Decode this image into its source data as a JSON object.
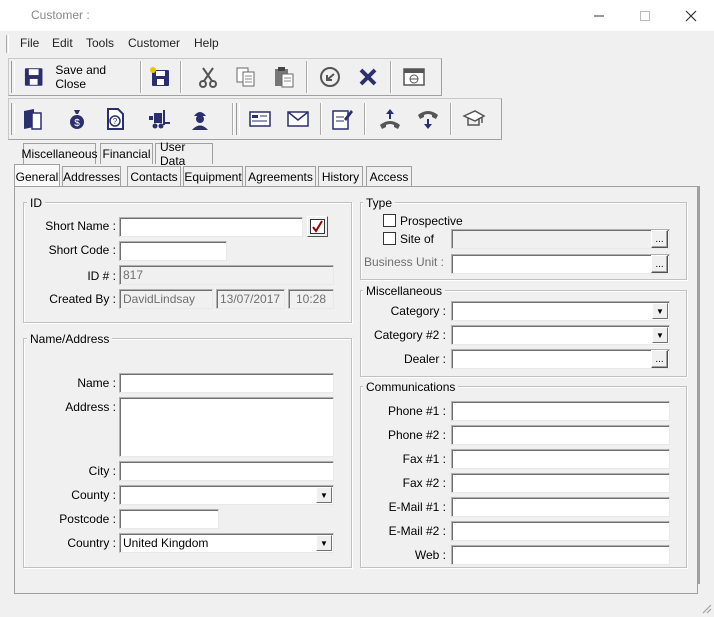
{
  "window": {
    "title": "Customer :",
    "minimize_icon": "minimize-icon",
    "maximize_icon": "maximize-icon",
    "close_icon": "close-icon"
  },
  "menu": {
    "items": [
      {
        "label": "File"
      },
      {
        "label": "Edit"
      },
      {
        "label": "Tools"
      },
      {
        "label": "Customer"
      },
      {
        "label": "Help"
      }
    ]
  },
  "toolbar1": {
    "save_close_label": "Save and Close",
    "buttons": [
      {
        "icon": "floppy-disk-icon"
      },
      {
        "icon": "save-new-icon"
      },
      {
        "icon": "cut-icon"
      },
      {
        "icon": "copy-icon"
      },
      {
        "icon": "paste-icon"
      },
      {
        "icon": "undo-icon"
      },
      {
        "icon": "delete-icon"
      },
      {
        "icon": "web-window-icon"
      }
    ]
  },
  "toolbar2": {
    "buttons": [
      {
        "icon": "book-icon"
      },
      {
        "icon": "money-bag-icon"
      },
      {
        "icon": "question-document-icon"
      },
      {
        "icon": "forklift-icon"
      },
      {
        "icon": "engineer-icon"
      },
      {
        "icon": "message-card-icon"
      },
      {
        "icon": "envelope-icon"
      },
      {
        "icon": "edit-note-icon"
      },
      {
        "icon": "phone-outgoing-icon"
      },
      {
        "icon": "phone-incoming-icon"
      },
      {
        "icon": "mortarboard-icon"
      }
    ]
  },
  "tabs_row1": [
    "Miscellaneous",
    "Financial",
    "User Data"
  ],
  "tabs_row2": [
    "General",
    "Addresses",
    "Contacts",
    "Equipment",
    "Agreements",
    "History",
    "Access"
  ],
  "active_tab": "General",
  "id_group": {
    "title": "ID",
    "short_name_label": "Short Name :",
    "short_name_value": "",
    "short_code_label": "Short Code :",
    "short_code_value": "",
    "id_label": "ID # :",
    "id_value": "817",
    "created_by_label": "Created By :",
    "created_by_user": "DavidLindsay",
    "created_date": "13/07/2017",
    "created_time": "10:28"
  },
  "name_address_group": {
    "title": "Name/Address",
    "name_label": "Name :",
    "name_value": "",
    "address_label": "Address :",
    "address_value": "",
    "city_label": "City :",
    "city_value": "",
    "county_label": "County :",
    "county_value": "",
    "postcode_label": "Postcode :",
    "postcode_value": "",
    "country_label": "Country :",
    "country_value": "United Kingdom"
  },
  "type_group": {
    "title": "Type",
    "prospective_label": "Prospective",
    "prospective_checked": false,
    "site_of_label": "Site of",
    "site_of_checked": false,
    "site_of_value": "",
    "business_unit_label": "Business Unit :",
    "business_unit_value": ""
  },
  "misc_group": {
    "title": "Miscellaneous",
    "category_label": "Category :",
    "category_value": "",
    "category2_label": "Category #2 :",
    "category2_value": "",
    "dealer_label": "Dealer :",
    "dealer_value": ""
  },
  "comms_group": {
    "title": "Communications",
    "phone1_label": "Phone #1 :",
    "phone2_label": "Phone #2 :",
    "fax1_label": "Fax #1 :",
    "fax2_label": "Fax #2 :",
    "email1_label": "E-Mail #1 :",
    "email2_label": "E-Mail #2 :",
    "web_label": "Web :",
    "phone1_value": "",
    "phone2_value": "",
    "fax1_value": "",
    "fax2_value": "",
    "email1_value": "",
    "email2_value": "",
    "web_value": ""
  },
  "ellipsis": "...",
  "colors": {
    "icon_primary": "#2b2f6e",
    "icon_accent": "#c8102e",
    "background": "#f0f0f0"
  }
}
